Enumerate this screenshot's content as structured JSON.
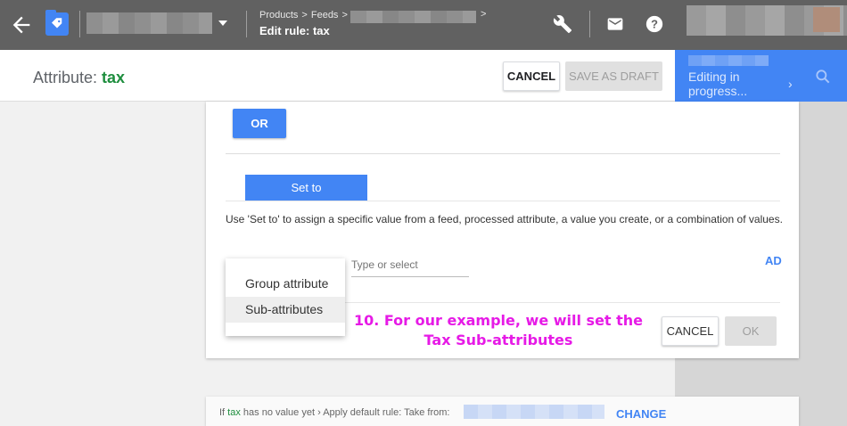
{
  "topbar": {
    "breadcrumbs": [
      "Products",
      "Feeds"
    ],
    "breadcrumb_sep": ">",
    "title": "Edit rule: tax",
    "icons": [
      "back-arrow-icon",
      "merchant-logo-icon",
      "dropdown-caret-icon",
      "wrench-icon",
      "mail-icon",
      "help-icon"
    ]
  },
  "header": {
    "attribute_prefix": "Attribute: ",
    "attribute_name": "tax",
    "cancel_label": "CANCEL",
    "save_draft_label": "SAVE AS DRAFT"
  },
  "progress_panel": {
    "status": "Editing in progress...",
    "color": "#4285f4"
  },
  "rule": {
    "or_label": "OR",
    "set_to_label": "Set to",
    "help_text": "Use 'Set to' to assign a specific value from a feed, processed attribute, a value you create, or a combination of values.",
    "input_placeholder": "Type or select",
    "add_link": "AD",
    "dropdown_options": [
      "Group attribute",
      "Sub-attributes"
    ],
    "highlighted_option": "Sub-attributes",
    "cancel_label": "CANCEL",
    "ok_label": "OK"
  },
  "annotation": {
    "text": "10. For our example, we will set the Tax Sub-attributes",
    "color": "#e61ae6"
  },
  "default_rule": {
    "prefix": "If ",
    "attr": "tax",
    "suffix": " has no value yet › Apply default rule: Take from:",
    "change_label": "CHANGE"
  }
}
